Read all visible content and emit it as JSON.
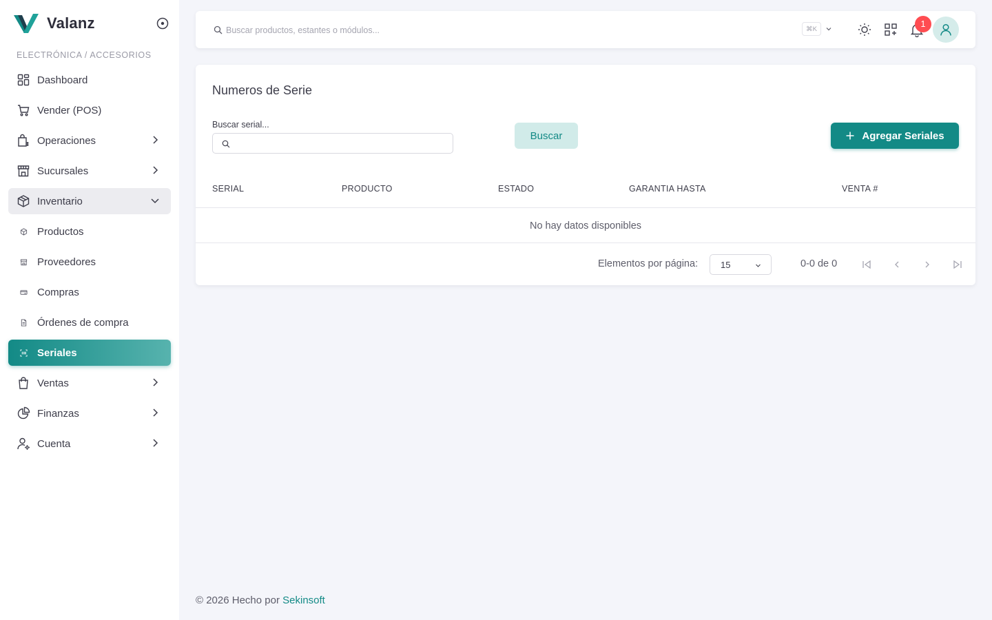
{
  "brand": {
    "name": "Valanz"
  },
  "sidebar": {
    "section_label": "ELECTRÓNICA / ACCESORIOS",
    "items": [
      {
        "label": "Dashboard",
        "icon": "dashboard-icon"
      },
      {
        "label": "Vender (POS)",
        "icon": "cart-icon"
      },
      {
        "label": "Operaciones",
        "icon": "operations-icon",
        "expandable": true
      },
      {
        "label": "Sucursales",
        "icon": "store-icon",
        "expandable": true
      },
      {
        "label": "Inventario",
        "icon": "box-icon",
        "expandable": true,
        "open": true
      },
      {
        "label": "Productos",
        "icon": "product-dot-icon",
        "sub": true
      },
      {
        "label": "Proveedores",
        "icon": "supplier-dot-icon",
        "sub": true
      },
      {
        "label": "Compras",
        "icon": "purchase-dot-icon",
        "sub": true
      },
      {
        "label": "Órdenes de compra",
        "icon": "order-dot-icon",
        "sub": true
      },
      {
        "label": "Seriales",
        "icon": "serial-dot-icon",
        "sub": true,
        "active": true
      },
      {
        "label": "Ventas",
        "icon": "shopping-bag-icon",
        "expandable": true
      },
      {
        "label": "Finanzas",
        "icon": "pie-chart-icon",
        "expandable": true
      },
      {
        "label": "Cuenta",
        "icon": "user-settings-icon",
        "expandable": true
      }
    ]
  },
  "topbar": {
    "search_placeholder": "Buscar productos, estantes o módulos...",
    "shortcut": "⌘K",
    "notifications_count": "1"
  },
  "page": {
    "title": "Numeros de Serie",
    "search_label": "Buscar serial...",
    "search_value": "",
    "search_button": "Buscar",
    "add_button": "Agregar Seriales"
  },
  "table": {
    "columns": [
      "SERIAL",
      "PRODUCTO",
      "ESTADO",
      "GARANTIA HASTA",
      "VENTA #"
    ],
    "empty_message": "No hay datos disponibles"
  },
  "pagination": {
    "per_page_label": "Elementos por página:",
    "per_page_value": "15",
    "range": "0-0 de 0"
  },
  "footer": {
    "prefix": "© 2026 Hecho por ",
    "link": "Sekinsoft"
  },
  "colors": {
    "accent": "#138a86",
    "accent_light": "#d1ebe9",
    "badge": "#ff4c51",
    "background": "#f4f5fa"
  }
}
